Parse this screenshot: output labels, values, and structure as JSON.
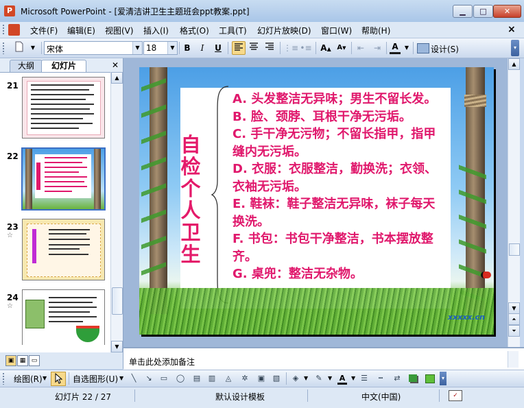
{
  "window": {
    "title": "Microsoft PowerPoint - [爱清洁讲卫生主题班会ppt教案.ppt]",
    "app_icon": "P",
    "controls": {
      "minimize_icon": "minimize-icon",
      "maximize_icon": "maximize-icon",
      "close_icon": "close-icon"
    }
  },
  "menubar": {
    "items": [
      "文件(F)",
      "编辑(E)",
      "视图(V)",
      "插入(I)",
      "格式(O)",
      "工具(T)",
      "幻灯片放映(D)",
      "窗口(W)",
      "帮助(H)"
    ],
    "close_glyph": "×"
  },
  "toolbar": {
    "font_name": "宋体",
    "font_size": "18",
    "bold": "B",
    "italic": "I",
    "underline": "U",
    "font_color_label": "A",
    "design_label": "设计(S)",
    "grow_font": "A",
    "shrink_font": "A"
  },
  "left_panel": {
    "tabs": {
      "outline": "大纲",
      "slides": "幻灯片"
    },
    "thumbs": [
      {
        "num": "21",
        "star": ""
      },
      {
        "num": "22",
        "star": ""
      },
      {
        "num": "23",
        "star": "☆"
      },
      {
        "num": "24",
        "star": "☆"
      }
    ]
  },
  "slide": {
    "heading": "自检个人卫生",
    "lines": [
      "A. 头发整洁无异味；男生不留长发。",
      "B. 脸、颈脖、耳根干净无污垢。",
      "C. 手干净无污物；不留长指甲，指甲缝内无污垢。",
      "D. 衣服：衣服整洁，勤换洗；衣领、衣袖无污垢。",
      "E. 鞋袜：鞋子整洁无异味，袜子每天换洗。",
      "F. 书包：书包干净整洁，书本摆放整齐。",
      "G. 桌兜：整洁无杂物。"
    ],
    "watermark": "xxxxx.cn"
  },
  "notes": {
    "placeholder": "单击此处添加备注"
  },
  "drawbar": {
    "draw_label": "绘图(R)",
    "autoshape_label": "自选图形(U)"
  },
  "status": {
    "slide_pos": "幻灯片 22 / 27",
    "template": "默认设计模板",
    "language": "中文(中国)"
  },
  "colors": {
    "slide_text": "#e0186c",
    "title_bar": "#a9c6e8"
  }
}
